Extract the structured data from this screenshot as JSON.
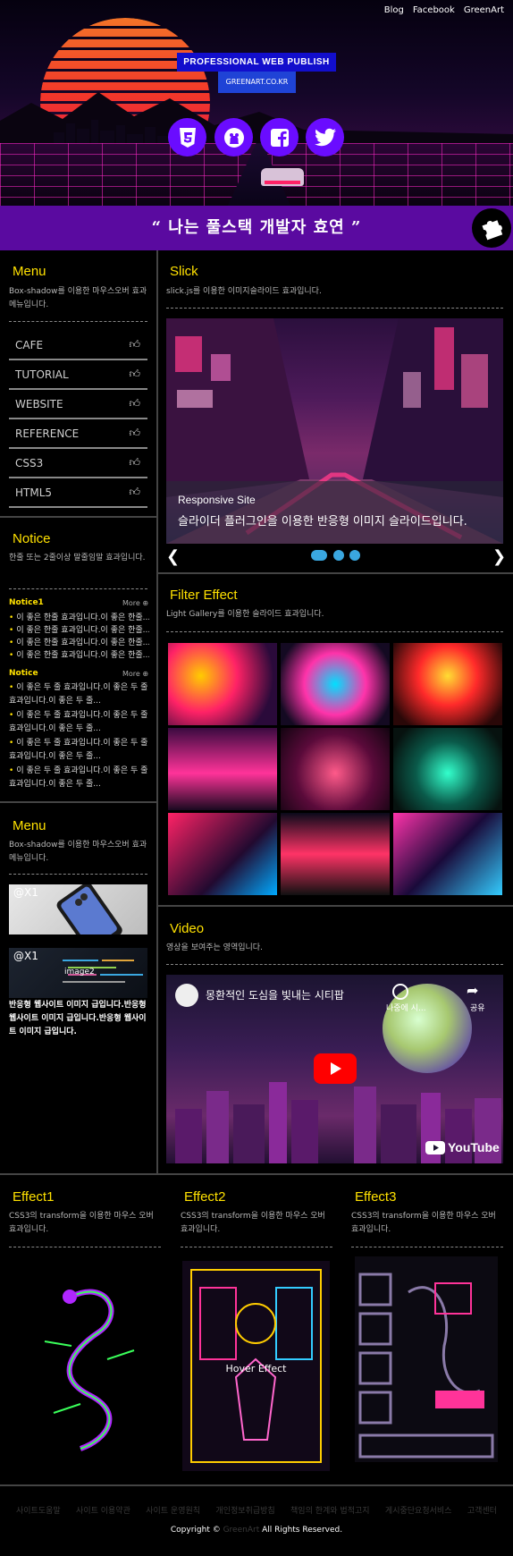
{
  "header": {
    "top_links": [
      "Blog",
      "Facebook",
      "GreenArt"
    ],
    "publish_title": "PROFESSIONAL WEB PUBLISH",
    "publish_domain": "GREENART.CO.KR",
    "social_icons": [
      "html5-icon",
      "github-icon",
      "facebook-icon",
      "twitter-icon"
    ]
  },
  "banner": {
    "quote": "“ 나는 풀스택 개발자 효연 ”"
  },
  "menu": {
    "title": "Menu",
    "desc": "Box-shadow를 이용한 마우스오버 효과 메뉴입니다.",
    "items": [
      "CAFE",
      "TUTORIAL",
      "WEBSITE",
      "REFERENCE",
      "CSS3",
      "HTML5"
    ]
  },
  "notice": {
    "title": "Notice",
    "desc": "한줄 또는 2줄이상 말줄임말 효과입니다.",
    "tab1": "Notice1",
    "tab2": "Notice",
    "more": "More",
    "list1": [
      "이 좋은 한줄 효과입니다.이 좋은 한줄...",
      "이 좋은 한줄 효과입니다.이 좋은 한줄...",
      "이 좋은 한줄 효과입니다.이 좋은 한줄...",
      "이 좋은 한줄 효과입니다.이 좋은 한줄..."
    ],
    "list2": [
      "이 좋은 두 줄 효과입니다.이 좋은 두 줄 효과입니다.이 좋은 두 줄...",
      "이 좋은 두 줄 효과입니다.이 좋은 두 줄 효과입니다.이 좋은 두 줄...",
      "이 좋은 두 줄 효과입니다.이 좋은 두 줄 효과입니다.이 좋은 두 줄...",
      "이 좋은 두 줄 효과입니다.이 좋은 두 줄 효과입니다.이 좋은 두 줄..."
    ]
  },
  "menu2": {
    "title": "Menu",
    "desc": "Box-shadow를 이용한 마우스오버 효과 메뉴입니다.",
    "image1_label": "@X1",
    "image2_label": "@X1",
    "image2_text": "image2",
    "caption": "반응형 웹사이트 이미지 급입니다.반응형 웹사이트 이미지 급입니다.반응형 웹사이트 이미지 급입니다."
  },
  "slick": {
    "title": "Slick",
    "desc": "slick.js를 이용한 이미지슬라이드 효과입니다.",
    "slide_title": "Responsive Site",
    "slide_desc": "슬라이더 플러그인을 이용한 반응형 이미지 슬라이드입니다.",
    "dots": 3,
    "active_dot": 1
  },
  "filter": {
    "title": "Filter Effect",
    "desc": "Light Gallery를 이용한 슬라이드 효과입니다."
  },
  "video": {
    "title": "Video",
    "desc": "영상을 보여주는 영역입니다.",
    "video_title": "몽환적인 도심을 빛내는 시티팝",
    "watch_later": "나중에 시...",
    "share": "공유",
    "youtube": "YouTube"
  },
  "effects": [
    {
      "title": "Effect1",
      "desc": "CSS3의 transform을 이용한 마우스 오버효과입니다."
    },
    {
      "title": "Effect2",
      "desc": "CSS3의 transform을 이용한 마우스 오버효과입니다.",
      "overlay": "Hover Effect"
    },
    {
      "title": "Effect3",
      "desc": "CSS3의 transform을 이용한 마우스 오버효과입니다."
    }
  ],
  "footer": {
    "links": [
      "사이트도움말",
      "사이트 이용약관",
      "사이트 운영원칙",
      "개인정보취급방침",
      "책임의 한계와 법적고지",
      "게시중단요청서비스",
      "고객센터"
    ],
    "copyright_prefix": "Copyright © ",
    "copyright_brand": "GreenArt",
    "copyright_suffix": " All Rights Reserved."
  },
  "colors": {
    "accent_yellow": "#ffe100",
    "banner_purple": "#5a0aa0",
    "social_purple": "#6a0cff",
    "publish_blue": "#120ecc",
    "slick_dot": "#3aa7e0"
  }
}
